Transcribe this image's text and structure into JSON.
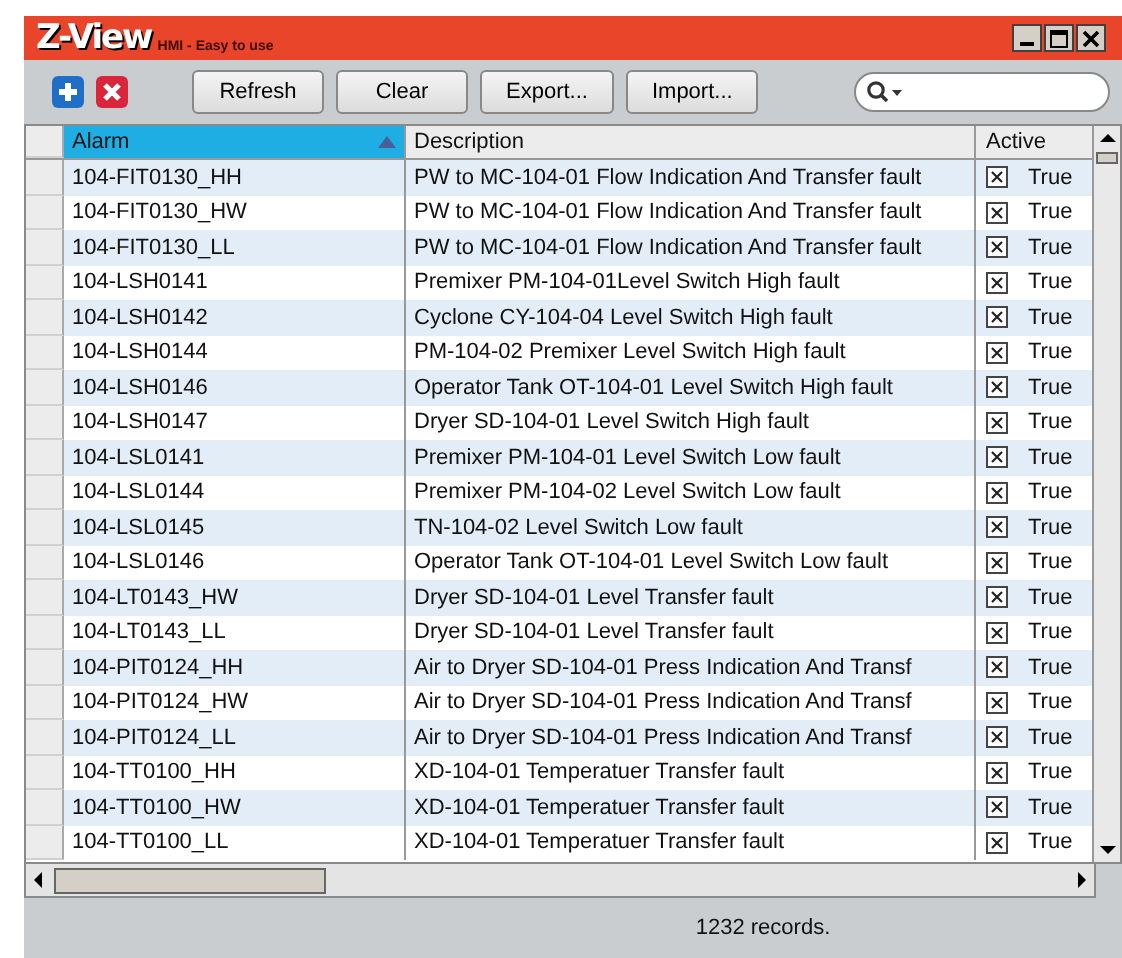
{
  "window": {
    "logo": "Z-View",
    "tagline": "HMI - Easy to use"
  },
  "toolbar": {
    "buttons": [
      "Refresh",
      "Clear",
      "Export...",
      "Import..."
    ]
  },
  "table": {
    "columns": [
      {
        "label": "Alarm",
        "selected": true,
        "sorted": true
      },
      {
        "label": "Description",
        "selected": false,
        "sorted": false
      },
      {
        "label": "Active",
        "selected": false,
        "sorted": false
      }
    ],
    "rows": [
      {
        "alarm": "104-FIT0130_HH",
        "description": "PW to MC-104-01 Flow Indication And Transfer fault",
        "checked": true,
        "active": "True"
      },
      {
        "alarm": "104-FIT0130_HW",
        "description": "PW to MC-104-01 Flow Indication And Transfer fault",
        "checked": true,
        "active": "True"
      },
      {
        "alarm": "104-FIT0130_LL",
        "description": "PW to MC-104-01 Flow Indication And Transfer fault",
        "checked": true,
        "active": "True"
      },
      {
        "alarm": "104-LSH0141",
        "description": "Premixer PM-104-01Level Switch High fault",
        "checked": true,
        "active": "True"
      },
      {
        "alarm": "104-LSH0142",
        "description": "Cyclone CY-104-04 Level Switch High fault",
        "checked": true,
        "active": "True"
      },
      {
        "alarm": "104-LSH0144",
        "description": "PM-104-02 Premixer Level Switch High fault",
        "checked": true,
        "active": "True"
      },
      {
        "alarm": "104-LSH0146",
        "description": "Operator Tank OT-104-01 Level Switch High fault",
        "checked": true,
        "active": "True"
      },
      {
        "alarm": "104-LSH0147",
        "description": "Dryer SD-104-01 Level Switch High fault",
        "checked": true,
        "active": "True"
      },
      {
        "alarm": "104-LSL0141",
        "description": "Premixer PM-104-01 Level Switch Low fault",
        "checked": true,
        "active": "True"
      },
      {
        "alarm": "104-LSL0144",
        "description": "Premixer PM-104-02 Level Switch Low fault",
        "checked": true,
        "active": "True"
      },
      {
        "alarm": "104-LSL0145",
        "description": "TN-104-02 Level Switch Low fault",
        "checked": true,
        "active": "True"
      },
      {
        "alarm": "104-LSL0146",
        "description": "Operator Tank OT-104-01 Level Switch Low fault",
        "checked": true,
        "active": "True"
      },
      {
        "alarm": "104-LT0143_HW",
        "description": "Dryer SD-104-01 Level Transfer fault",
        "checked": true,
        "active": "True"
      },
      {
        "alarm": "104-LT0143_LL",
        "description": "Dryer SD-104-01 Level Transfer fault",
        "checked": true,
        "active": "True"
      },
      {
        "alarm": "104-PIT0124_HH",
        "description": "Air to Dryer SD-104-01 Press Indication And Transf",
        "checked": true,
        "active": "True"
      },
      {
        "alarm": "104-PIT0124_HW",
        "description": "Air to Dryer SD-104-01 Press Indication And Transf",
        "checked": true,
        "active": "True"
      },
      {
        "alarm": "104-PIT0124_LL",
        "description": "Air to Dryer SD-104-01 Press Indication And Transf",
        "checked": true,
        "active": "True"
      },
      {
        "alarm": "104-TT0100_HH",
        "description": "XD-104-01 Temperatuer Transfer fault",
        "checked": true,
        "active": "True"
      },
      {
        "alarm": "104-TT0100_HW",
        "description": "XD-104-01 Temperatuer Transfer fault",
        "checked": true,
        "active": "True"
      },
      {
        "alarm": "104-TT0100_LL",
        "description": "XD-104-01 Temperatuer Transfer fault",
        "checked": true,
        "active": "True"
      }
    ]
  },
  "status_bar": {
    "text": "1232 records."
  }
}
